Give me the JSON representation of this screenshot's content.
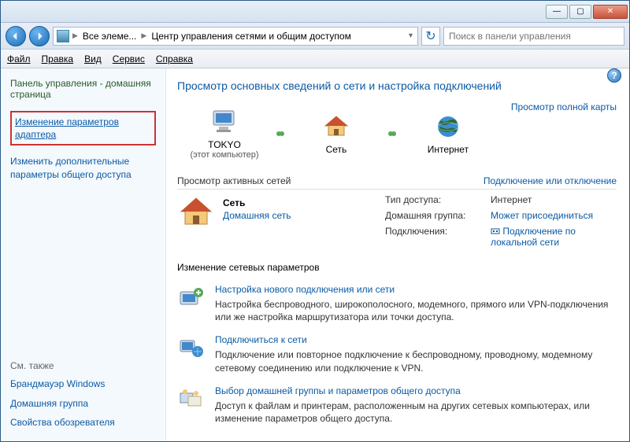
{
  "titlebar": {
    "min": "—",
    "max": "▢",
    "close": "✕"
  },
  "nav": {
    "path_first": "Все элеме...",
    "path_second": "Центр управления сетями и общим доступом",
    "search_placeholder": "Поиск в панели управления"
  },
  "menu": {
    "file": "Файл",
    "edit": "Правка",
    "view": "Вид",
    "tools": "Сервис",
    "help": "Справка"
  },
  "sidebar": {
    "heading": "Панель управления - домашняя страница",
    "adapter_link": "Изменение параметров адаптера",
    "sharing_link": "Изменить дополнительные параметры общего доступа",
    "see_also": "См. также",
    "firewall": "Брандмауэр Windows",
    "homegroup": "Домашняя группа",
    "ie": "Свойства обозревателя"
  },
  "main": {
    "title": "Просмотр основных сведений о сети и настройка подключений",
    "full_map": "Просмотр полной карты",
    "map": {
      "node1": "TOKYO",
      "node1_sub": "(этот компьютер)",
      "node2": "Сеть",
      "node3": "Интернет"
    },
    "active_nets": "Просмотр активных сетей",
    "connect_disconnect": "Подключение или отключение",
    "net": {
      "name": "Сеть",
      "type": "Домашняя сеть",
      "k1": "Тип доступа:",
      "v1": "Интернет",
      "k2": "Домашняя группа:",
      "v2": "Может присоединиться",
      "k3": "Подключения:",
      "v3": "Подключение по локальной сети"
    },
    "params_head": "Изменение сетевых параметров",
    "task1_t": "Настройка нового подключения или сети",
    "task1_d": "Настройка беспроводного, широкополосного, модемного, прямого или VPN-подключения или же настройка маршрутизатора или точки доступа.",
    "task2_t": "Подключиться к сети",
    "task2_d": "Подключение или повторное подключение к беспроводному, проводному, модемному сетевому соединению или подключение к VPN.",
    "task3_t": "Выбор домашней группы и параметров общего доступа",
    "task3_d": "Доступ к файлам и принтерам, расположенным на других сетевых компьютерах, или изменение параметров общего доступа."
  }
}
